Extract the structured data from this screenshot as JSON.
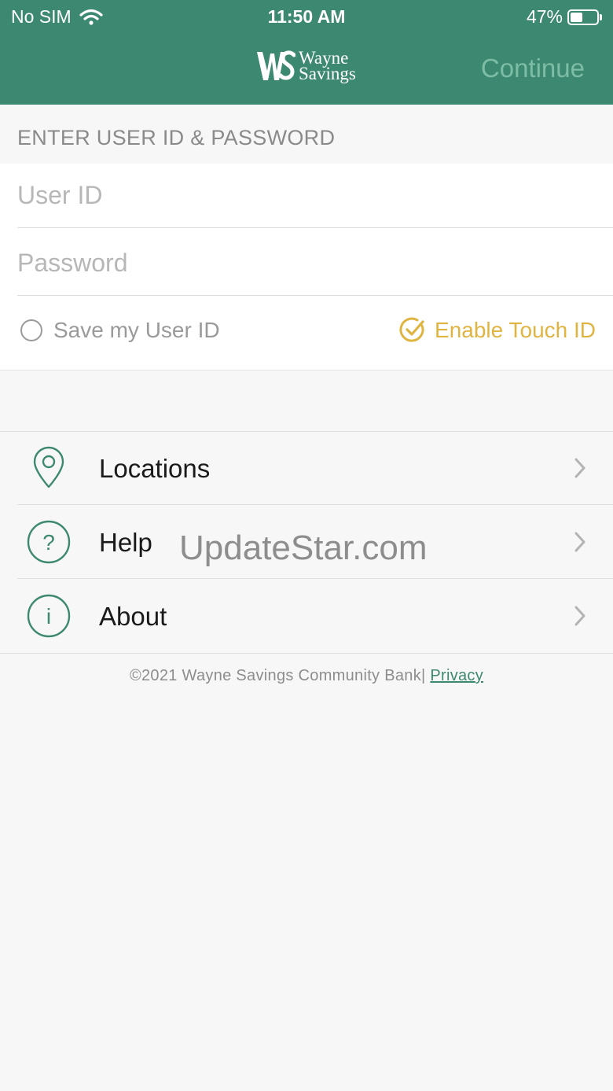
{
  "status_bar": {
    "carrier": "No SIM",
    "time": "11:50 AM",
    "battery": "47%",
    "battery_level": 0.47
  },
  "header": {
    "logo_monogram": "WS",
    "logo_line1": "Wayne",
    "logo_line2": "Savings",
    "continue_label": "Continue",
    "bg_color": "#3d8870"
  },
  "login": {
    "section_title": "ENTER USER ID & PASSWORD",
    "user_id_placeholder": "User ID",
    "user_id_value": "",
    "password_placeholder": "Password",
    "password_value": "",
    "save_user_id_label": "Save my User ID",
    "save_user_id_checked": false,
    "touch_id_label": "Enable Touch ID",
    "touch_id_enabled": true,
    "accent_color": "#e0b441"
  },
  "menu": {
    "items": [
      {
        "label": "Locations",
        "icon": "location-pin-icon"
      },
      {
        "label": "Help",
        "icon": "question-circle-icon"
      },
      {
        "label": "About",
        "icon": "info-circle-icon"
      }
    ]
  },
  "watermark": "UpdateStar.com",
  "footer": {
    "copyright": "©2021 Wayne Savings Community Bank| ",
    "privacy_link": "Privacy"
  }
}
